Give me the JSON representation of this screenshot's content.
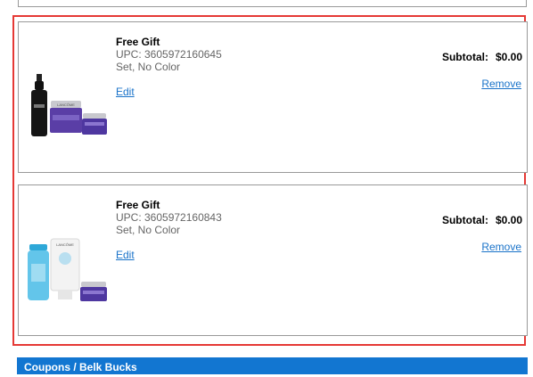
{
  "cart_items": [
    {
      "title": "Free Gift",
      "upc": "UPC: 3605972160645",
      "variant": "Set, No Color",
      "edit_label": "Edit",
      "subtotal_label": "Subtotal:",
      "subtotal_value": "$0.00",
      "remove_label": "Remove"
    },
    {
      "title": "Free Gift",
      "upc": "UPC: 3605972160843",
      "variant": "Set, No Color",
      "edit_label": "Edit",
      "subtotal_label": "Subtotal:",
      "subtotal_value": "$0.00",
      "remove_label": "Remove"
    }
  ],
  "product_images": {
    "brand_mark": "LANCÔME"
  },
  "coupons_section": {
    "title": "Coupons / Belk Bucks"
  },
  "colors": {
    "link": "#1a73c9",
    "section_bar": "#1276d1",
    "highlight": "#e53935"
  }
}
